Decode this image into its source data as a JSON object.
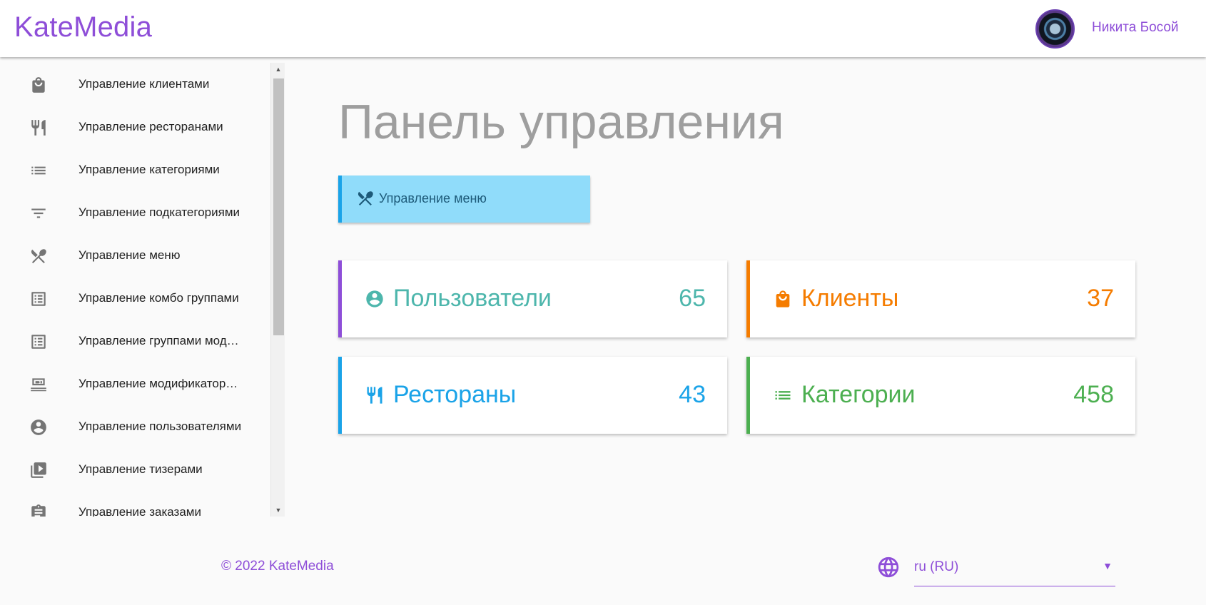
{
  "header": {
    "brand": "KateMedia",
    "user_name": "Никита Босой"
  },
  "sidebar": {
    "items": [
      {
        "label": "Управление клиентами",
        "icon": "shopping-bag-icon"
      },
      {
        "label": "Управление ресторанами",
        "icon": "fork-knife-icon"
      },
      {
        "label": "Управление категориями",
        "icon": "list-icon"
      },
      {
        "label": "Управление подкатегориями",
        "icon": "filter-icon"
      },
      {
        "label": "Управление меню",
        "icon": "utensils-crossed-icon"
      },
      {
        "label": "Управление комбо группами",
        "icon": "list-box-icon"
      },
      {
        "label": "Управление группами модификаторов",
        "icon": "list-box-icon"
      },
      {
        "label": "Управление модификаторами",
        "icon": "dish-icon"
      },
      {
        "label": "Управление пользователями",
        "icon": "account-circle-icon"
      },
      {
        "label": "Управление тизерами",
        "icon": "video-library-icon"
      },
      {
        "label": "Управление заказами",
        "icon": "clipboard-icon"
      }
    ]
  },
  "main": {
    "title": "Панель управления",
    "menu_button_label": "Управление меню",
    "cards": [
      {
        "label": "Пользователи",
        "value": "65",
        "icon": "account-circle-icon",
        "text_color": "#4db6ac",
        "accent_color": "#8e4ed8"
      },
      {
        "label": "Клиенты",
        "value": "37",
        "icon": "shopping-bag-icon",
        "text_color": "#f57c00",
        "accent_color": "#f57c00"
      },
      {
        "label": "Рестораны",
        "value": "43",
        "icon": "fork-knife-icon",
        "text_color": "#1aa3e8",
        "accent_color": "#1aa3e8"
      },
      {
        "label": "Категории",
        "value": "458",
        "icon": "list-icon",
        "text_color": "#4caf50",
        "accent_color": "#4caf50"
      }
    ]
  },
  "footer": {
    "copyright": "© 2022 KateMedia",
    "language": "ru (RU)"
  },
  "colors": {
    "brand": "#8e4ed8",
    "menu_button_bg": "#90dcfa",
    "menu_button_accent": "#1aa3e8"
  }
}
